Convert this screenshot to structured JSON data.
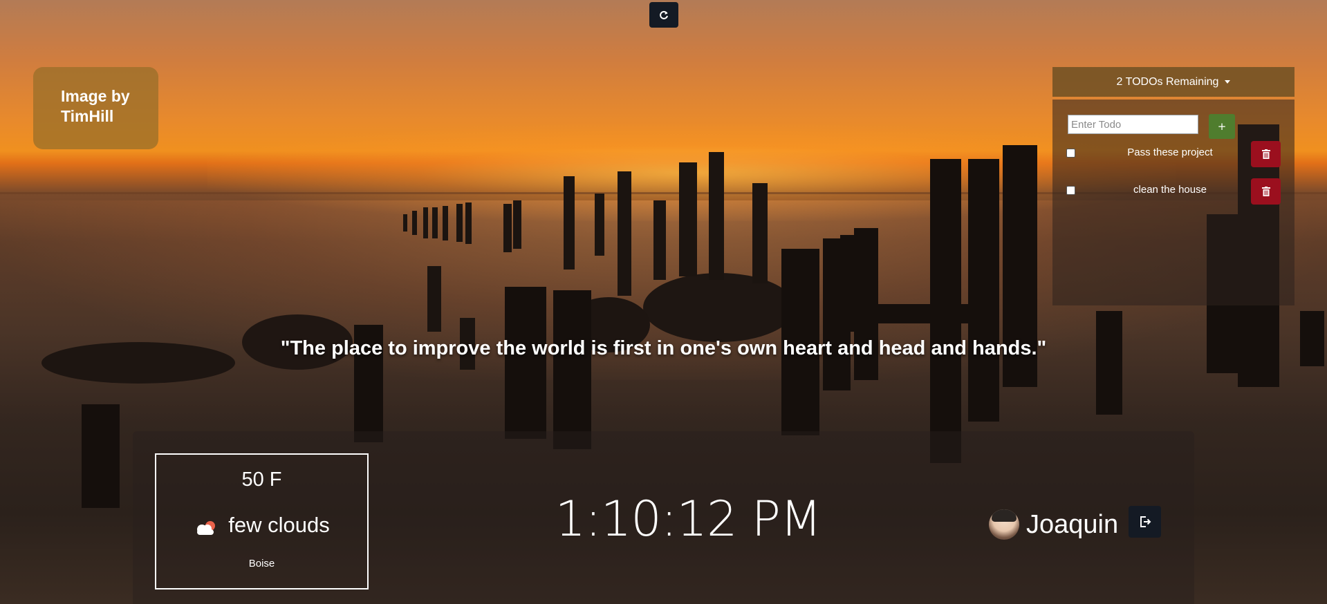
{
  "toolbar": {
    "refresh_icon": "refresh-icon"
  },
  "credit": {
    "text": "Image by TimHill"
  },
  "todos": {
    "header": "2 TODOs Remaining",
    "input_placeholder": "Enter Todo",
    "add_label": "+",
    "items": [
      {
        "text": "Pass these project",
        "done": false
      },
      {
        "text": "clean the house",
        "done": false
      }
    ]
  },
  "quote": {
    "text": "\"The place to improve the world is first in one's own heart and head and hands.\""
  },
  "weather": {
    "temperature": "50 F",
    "condition": "few clouds",
    "condition_icon": "cloud-icon",
    "city": "Boise"
  },
  "clock": {
    "time": "1:10:12 PM"
  },
  "user": {
    "name": "Joaquin",
    "logout_icon": "logout-icon"
  },
  "colors": {
    "button_dark": "#141a24",
    "todo_add": "#4f7d2e",
    "todo_delete": "#9b0f1e",
    "credit_bg": "#966e28"
  }
}
